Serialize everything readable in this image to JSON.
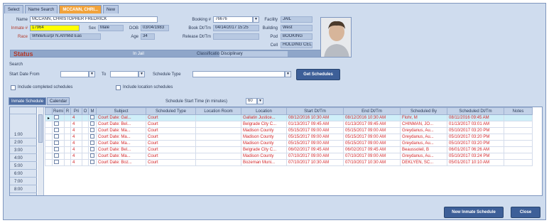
{
  "tabs": [
    {
      "label": "Select"
    },
    {
      "label": "Name Search"
    },
    {
      "label": "MCCANN, CHRI..."
    },
    {
      "label": "New"
    }
  ],
  "header": {
    "name_label": "Name",
    "name_value": "MCCANN, CHRISTOPHER FREDRICK",
    "inmate_label": "Inmate #",
    "inmate_value": "17964",
    "sex_label": "Sex",
    "sex_value": "Male",
    "dob_label": "DOB",
    "dob_value": "03/04/1983",
    "race_label": "Race",
    "race_value": "White/Eurp/ N.Afr/Mid Eas",
    "age_label": "Age",
    "age_value": "34",
    "booking_label": "Booking #",
    "booking_value": "76676",
    "bookdt_label": "Book Dt/Tm",
    "bookdt_value": "04/14/2017 15:25",
    "release_label": "Release Dt/Tm",
    "release_value": "",
    "facility_label": "Facility",
    "facility_value": "JAIL",
    "building_label": "Building",
    "building_value": "West",
    "pod_label": "Pod",
    "pod_value": "BOOKING",
    "cell_label": "Cell",
    "cell_value": "HOLDING CEL",
    "status_label": "Status",
    "status_value": "In Jail",
    "classification_label": "Classification",
    "classification_value": "Disciplinary"
  },
  "search": {
    "title": "Search",
    "start_from_label": "Start Date From",
    "to_label": "To",
    "type_label": "Schedule Type",
    "start_from_value": "",
    "to_value": "",
    "type_value": "",
    "get_button": "Get Schedules",
    "completed_label": "Include completed schedules",
    "location_label": "Include location schedules"
  },
  "subtabs": [
    {
      "label": "Inmate Schedule"
    },
    {
      "label": "Calendar"
    }
  ],
  "interval": {
    "label": "Schedule Start Time (in minutes)",
    "value": "60"
  },
  "times": [
    "",
    "1:00",
    "2:00",
    "3:00",
    "4:00",
    "5:00",
    "6:00",
    "7:00",
    "8:00"
  ],
  "columns": [
    "Remi",
    "R",
    "Pri",
    "O",
    "M",
    "Subject",
    "Scheduled Type",
    "Location Room",
    "Location",
    "Start Dt/Tm",
    "End Dt/Tm",
    "Scheduled By",
    "Scheduled Dt/Tm",
    "Notes"
  ],
  "rows": [
    {
      "pri": "4",
      "subject": "Court Date: Gal...",
      "type": "Court",
      "room": "",
      "location": "Gallatin Justice...",
      "start": "08/12/2016 10:30 AM",
      "end": "08/12/2016 10:30 AM",
      "by": "Flohr, M",
      "sched": "08/11/2016 09:45 AM",
      "notes": ""
    },
    {
      "pri": "4",
      "subject": "Court Date: Bel...",
      "type": "Court",
      "room": "",
      "location": "Belgrade City C...",
      "start": "01/13/2017 09:45 AM",
      "end": "01/13/2017 09:45 AM",
      "by": "CHINMAN, JO...",
      "sched": "01/13/2017 03:01 AM",
      "notes": ""
    },
    {
      "pri": "4",
      "subject": "Court Date: Ma...",
      "type": "Court",
      "room": "",
      "location": "Madison County",
      "start": "05/15/2017 09:00 AM",
      "end": "05/15/2017 09:00 AM",
      "by": "Greydanus, Au...",
      "sched": "05/10/2017 03:20 PM",
      "notes": ""
    },
    {
      "pri": "4",
      "subject": "Court Date: Ma...",
      "type": "Court",
      "room": "",
      "location": "Madison County",
      "start": "05/15/2017 09:00 AM",
      "end": "05/15/2017 09:00 AM",
      "by": "Greydanus, Au...",
      "sched": "05/10/2017 03:20 PM",
      "notes": ""
    },
    {
      "pri": "4",
      "subject": "Court Date: Ma...",
      "type": "Court",
      "room": "",
      "location": "Madison County",
      "start": "05/15/2017 09:00 AM",
      "end": "05/15/2017 09:00 AM",
      "by": "Greydanus, Au...",
      "sched": "05/10/2017 03:20 PM",
      "notes": ""
    },
    {
      "pri": "4",
      "subject": "Court Date: Bel...",
      "type": "Court",
      "room": "",
      "location": "Belgrade City C...",
      "start": "06/02/2017 09:45 AM",
      "end": "06/02/2017 09:45 AM",
      "by": "Beaussoleil, B",
      "sched": "06/01/2017 06:26 AM",
      "notes": ""
    },
    {
      "pri": "4",
      "subject": "Court Date: Ma...",
      "type": "Court",
      "room": "",
      "location": "Madison County",
      "start": "07/10/2017 09:00 AM",
      "end": "07/10/2017 09:00 AM",
      "by": "Greydanus, Au...",
      "sched": "05/10/2017 03:24 PM",
      "notes": ""
    },
    {
      "pri": "4",
      "subject": "Court Date: Boz...",
      "type": "Court",
      "room": "",
      "location": "Bozeman Muni...",
      "start": "07/10/2017 10:30 AM",
      "end": "07/10/2017 10:30 AM",
      "by": "DEKLYEN, SC...",
      "sched": "05/01/2017 10:10 AM",
      "notes": ""
    }
  ],
  "footer": {
    "new_button": "New Inmate Schedule",
    "close_button": "Close"
  },
  "colors": {
    "accent_tab": "#f1a33b",
    "button": "#3d5f98",
    "row_text": "#d2262a",
    "inmate_field": "#ffff00"
  }
}
